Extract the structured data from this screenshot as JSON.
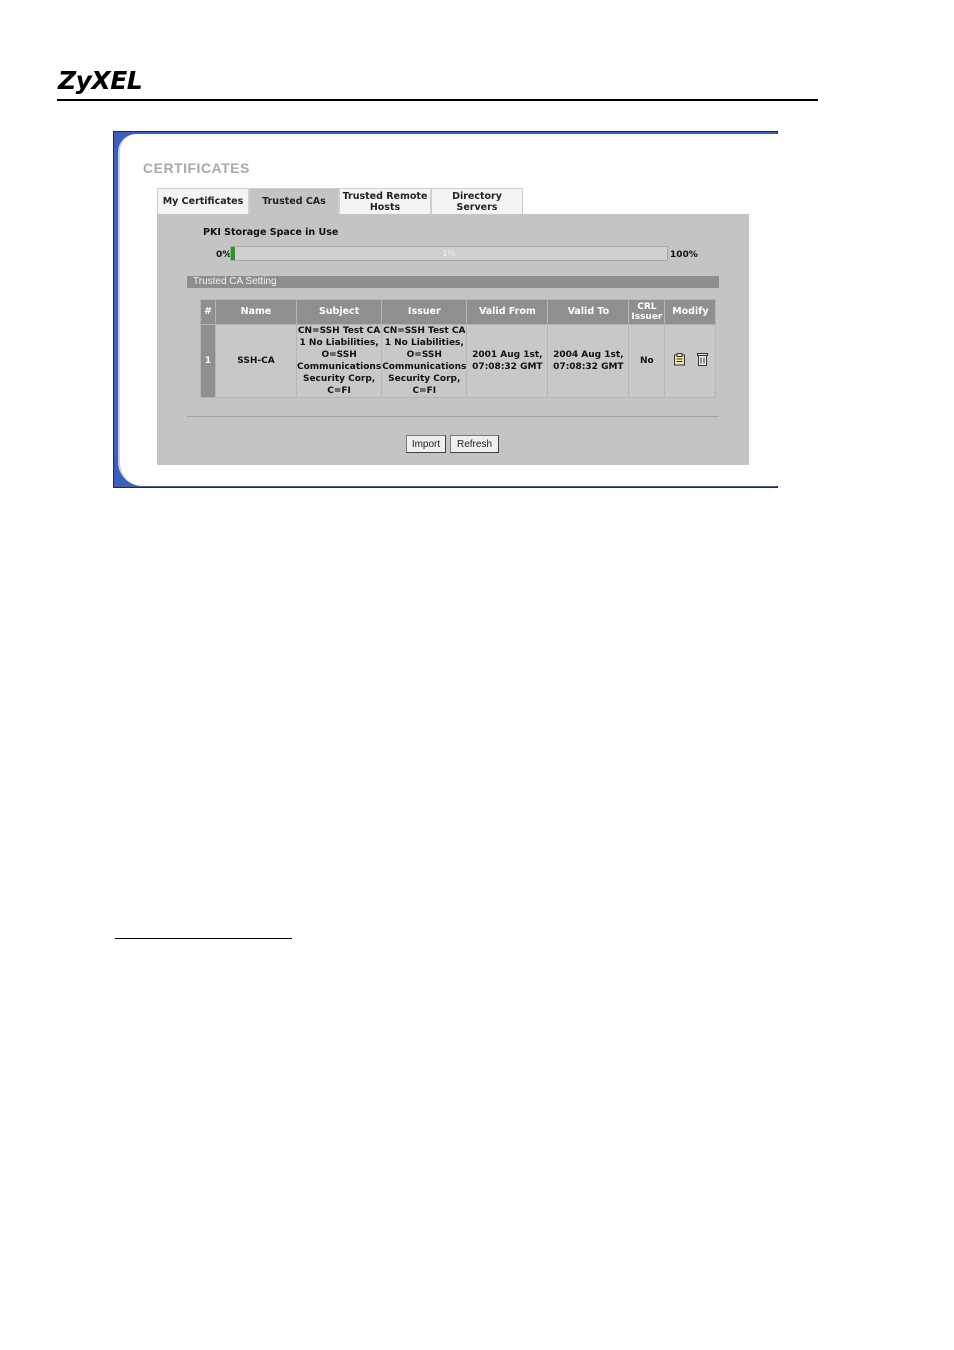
{
  "brand": {
    "logo": "ZyXEL"
  },
  "panel": {
    "title": "CERTIFICATES",
    "tabs": [
      {
        "label": "My Certificates",
        "active": false
      },
      {
        "label": "Trusted CAs",
        "active": true
      },
      {
        "label": "Trusted Remote\nHosts",
        "active": false
      },
      {
        "label": "Directory Servers",
        "active": false
      }
    ],
    "storage": {
      "label": "PKI Storage Space in Use",
      "min_label": "0%",
      "max_label": "100%",
      "used_percent": 1,
      "used_label": "1%"
    },
    "section_title": "Trusted CA Setting",
    "table": {
      "headers": [
        "#",
        "Name",
        "Subject",
        "Issuer",
        "Valid From",
        "Valid To",
        "CRL\nIssuer",
        "Modify"
      ],
      "rows": [
        {
          "index": "1",
          "name": "SSH-CA",
          "subject": "CN=SSH Test CA\n1 No Liabilities,\nO=SSH\nCommunications\nSecurity Corp,\nC=FI",
          "issuer": "CN=SSH Test CA\n1 No Liabilities,\nO=SSH\nCommunications\nSecurity Corp,\nC=FI",
          "valid_from": "2001 Aug 1st,\n07:08:32 GMT",
          "valid_to": "2004 Aug 1st,\n07:08:32 GMT",
          "crl_issuer": "No",
          "modify_icons": [
            "edit-icon",
            "delete-icon"
          ]
        }
      ]
    },
    "buttons": {
      "import": "Import",
      "refresh": "Refresh"
    }
  }
}
